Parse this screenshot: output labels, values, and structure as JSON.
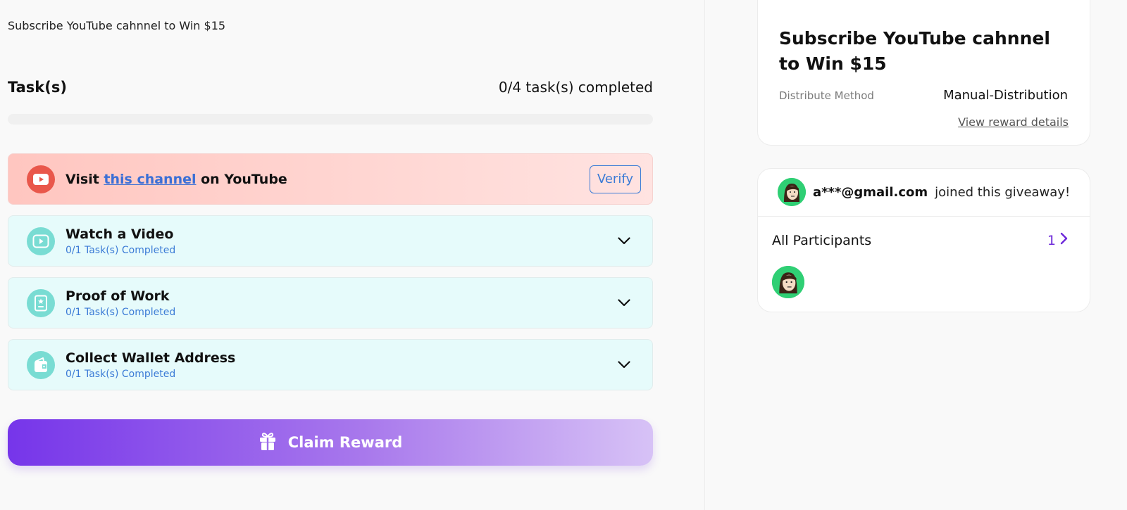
{
  "campaign": {
    "description": "Subscribe YouTube cahnnel to Win $15"
  },
  "tasks": {
    "heading": "Task(s)",
    "completed_text": "0/4 task(s) completed",
    "progress_fraction": 0,
    "items": [
      {
        "prefix": "Visit ",
        "link_text": "this channel",
        "suffix": " on YouTube",
        "action_label": "Verify",
        "icon": "youtube-icon"
      },
      {
        "title": "Watch a Video",
        "subtitle": "0/1 Task(s) Completed",
        "icon": "video-play-icon"
      },
      {
        "title": "Proof of Work",
        "subtitle": "0/1 Task(s) Completed",
        "icon": "badge-document-icon"
      },
      {
        "title": "Collect Wallet Address",
        "subtitle": "0/1 Task(s) Completed",
        "icon": "wallet-icon"
      }
    ]
  },
  "claim": {
    "label": "Claim Reward",
    "icon": "gift-icon"
  },
  "reward_card": {
    "title": "Subscribe YouTube cahnnel to Win $15",
    "distribute_label": "Distribute Method",
    "distribute_value": "Manual-Distribution",
    "view_details": "View reward details"
  },
  "participants": {
    "recent_email": "a***@gmail.com",
    "recent_text": "joined this giveaway!",
    "heading": "All Participants",
    "count": "1"
  },
  "colors": {
    "accent": "#7c3aed",
    "link": "#3b7bd6",
    "youtube_red": "#e9574b",
    "teal": "#79dcd3",
    "avatar_green": "#2fcf74"
  }
}
